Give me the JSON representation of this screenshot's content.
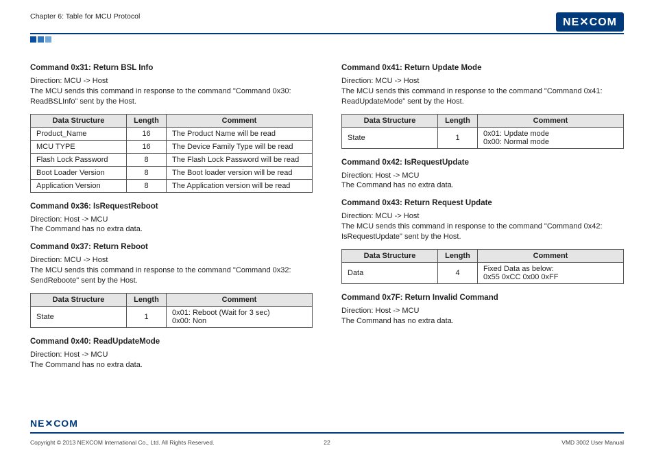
{
  "header": {
    "chapter": "Chapter 6: Table for MCU Protocol",
    "logo": "NEXCOM"
  },
  "left": {
    "cmd31": {
      "title": "Command 0x31: Return BSL Info",
      "dir": "Direction: MCU -> Host",
      "desc": "The MCU sends this command in response to the command \"Command 0x30: ReadBSLInfo\" sent by the Host.",
      "headers": {
        "ds": "Data Structure",
        "len": "Length",
        "com": "Comment"
      },
      "rows": [
        {
          "ds": "Product_Name",
          "len": "16",
          "com": "The Product Name will be read"
        },
        {
          "ds": "MCU TYPE",
          "len": "16",
          "com": "The Device Family Type will be read"
        },
        {
          "ds": "Flash Lock Password",
          "len": "8",
          "com": "The Flash Lock Password will be read"
        },
        {
          "ds": "Boot Loader Version",
          "len": "8",
          "com": "The Boot loader version will be read"
        },
        {
          "ds": "Application Version",
          "len": "8",
          "com": "The Application version will be read"
        }
      ]
    },
    "cmd36": {
      "title": "Command 0x36: IsRequestReboot",
      "dir": "Direction: Host -> MCU",
      "desc": "The Command has no extra data."
    },
    "cmd37": {
      "title": "Command 0x37: Return Reboot",
      "dir": "Direction: MCU -> Host",
      "desc": "The MCU sends this command in response to the command \"Command 0x32: SendReboote\" sent by the Host.",
      "headers": {
        "ds": "Data Structure",
        "len": "Length",
        "com": "Comment"
      },
      "row": {
        "ds": "State",
        "len": "1",
        "com1": "0x01: Reboot (Wait for 3 sec)",
        "com2": "0x00: Non"
      }
    },
    "cmd40": {
      "title": "Command 0x40: ReadUpdateMode",
      "dir": "Direction: Host -> MCU",
      "desc": "The Command has no extra data."
    }
  },
  "right": {
    "cmd41": {
      "title": "Command 0x41: Return Update Mode",
      "dir": "Direction: MCU -> Host",
      "desc": "The MCU sends this command in response to the command \"Command 0x41: ReadUpdateMode\" sent by the Host.",
      "headers": {
        "ds": "Data Structure",
        "len": "Length",
        "com": "Comment"
      },
      "row": {
        "ds": "State",
        "len": "1",
        "com1": "0x01: Update mode",
        "com2": "0x00: Normal mode"
      }
    },
    "cmd42": {
      "title": "Command 0x42: IsRequestUpdate",
      "dir": "Direction: Host -> MCU",
      "desc": "The Command has no extra data."
    },
    "cmd43": {
      "title": "Command 0x43: Return Request Update",
      "dir": "Direction: MCU -> Host",
      "desc": "The MCU sends this command in response to the command \"Command 0x42: IsRequestUpdate\" sent by the Host.",
      "headers": {
        "ds": "Data Structure",
        "len": "Length",
        "com": "Comment"
      },
      "row": {
        "ds": "Data",
        "len": "4",
        "com1": "Fixed Data as below:",
        "com2": "0x55 0xCC 0x00 0xFF"
      }
    },
    "cmd7f": {
      "title": "Command 0x7F: Return Invalid Command",
      "dir": "Direction: Host -> MCU",
      "desc": "The Command has no extra data."
    }
  },
  "footer": {
    "logo": "NEXCOM",
    "copy": "Copyright © 2013 NEXCOM International Co., Ltd. All Rights Reserved.",
    "page": "22",
    "manual": "VMD 3002 User Manual"
  }
}
